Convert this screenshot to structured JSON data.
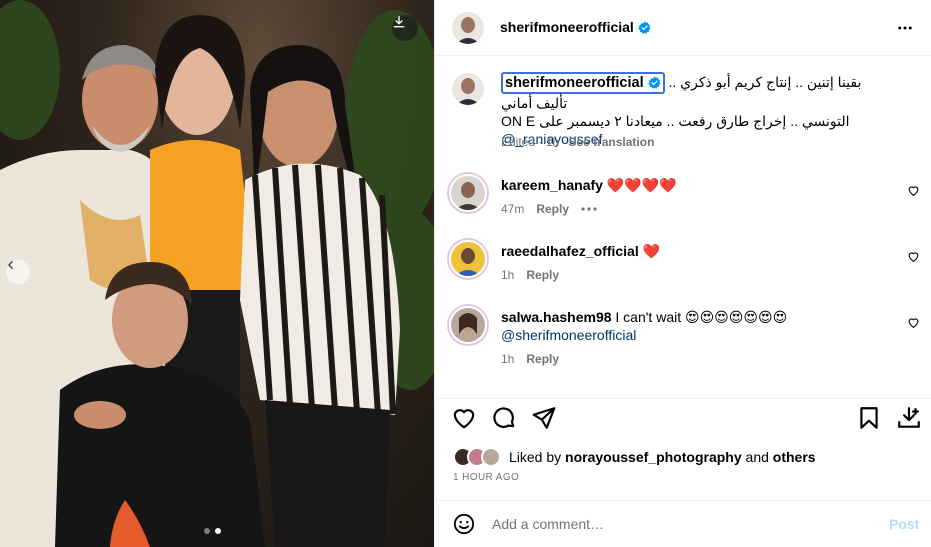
{
  "photo": {
    "download_icon": "download-icon",
    "prev_icon": "chevron-left-icon",
    "carousel_total": 2,
    "carousel_index": 2
  },
  "header": {
    "username": "sherifmoneerofficial",
    "verified_icon": "verified-badge-icon",
    "more_icon": "more-horizontal-icon"
  },
  "caption": {
    "username": "sherifmoneerofficial",
    "text_line1": "بقينا إتنين .. إنتاج كريم أبو ذكري .. تأليف أماني",
    "text_line2": "التونسي .. إخراج طارق رفعت .. ميعادنا ٢ ديسمبر على ON E",
    "mention": "@_raniayoussef",
    "edited": "Edited · 1h",
    "see_translation": "See translation"
  },
  "comments": [
    {
      "username": "kareem_hanafy",
      "text": "❤️❤️❤️❤️",
      "mention": "",
      "time": "47m",
      "reply": "Reply",
      "has_more": true
    },
    {
      "username": "raeedalhafez_official",
      "text": "❤️",
      "mention": "",
      "time": "1h",
      "reply": "Reply",
      "has_more": false
    },
    {
      "username": "salwa.hashem98",
      "text": "I can't wait 😍😍😍😍😍😍😍",
      "mention": "@sherifmoneerofficial",
      "time": "1h",
      "reply": "Reply",
      "has_more": false
    }
  ],
  "actions": {
    "like_icon": "heart-icon",
    "comment_icon": "comment-icon",
    "share_icon": "send-icon",
    "save_icon": "bookmark-icon",
    "download_icon": "download-icon"
  },
  "likes": {
    "prefix": "Liked by",
    "user": "norayoussef_photography",
    "connector": "and",
    "others": "others"
  },
  "timestamp": "1 HOUR AGO",
  "add_comment": {
    "emoji_icon": "smiley-icon",
    "placeholder": "Add a comment…",
    "post_label": "Post"
  },
  "colors": {
    "verified": "#0095f6",
    "mention": "#00376b",
    "muted": "#737373",
    "post_disabled": "#b2dffc",
    "heart": "#ed4956",
    "story_ring": "#e3c4e7"
  }
}
